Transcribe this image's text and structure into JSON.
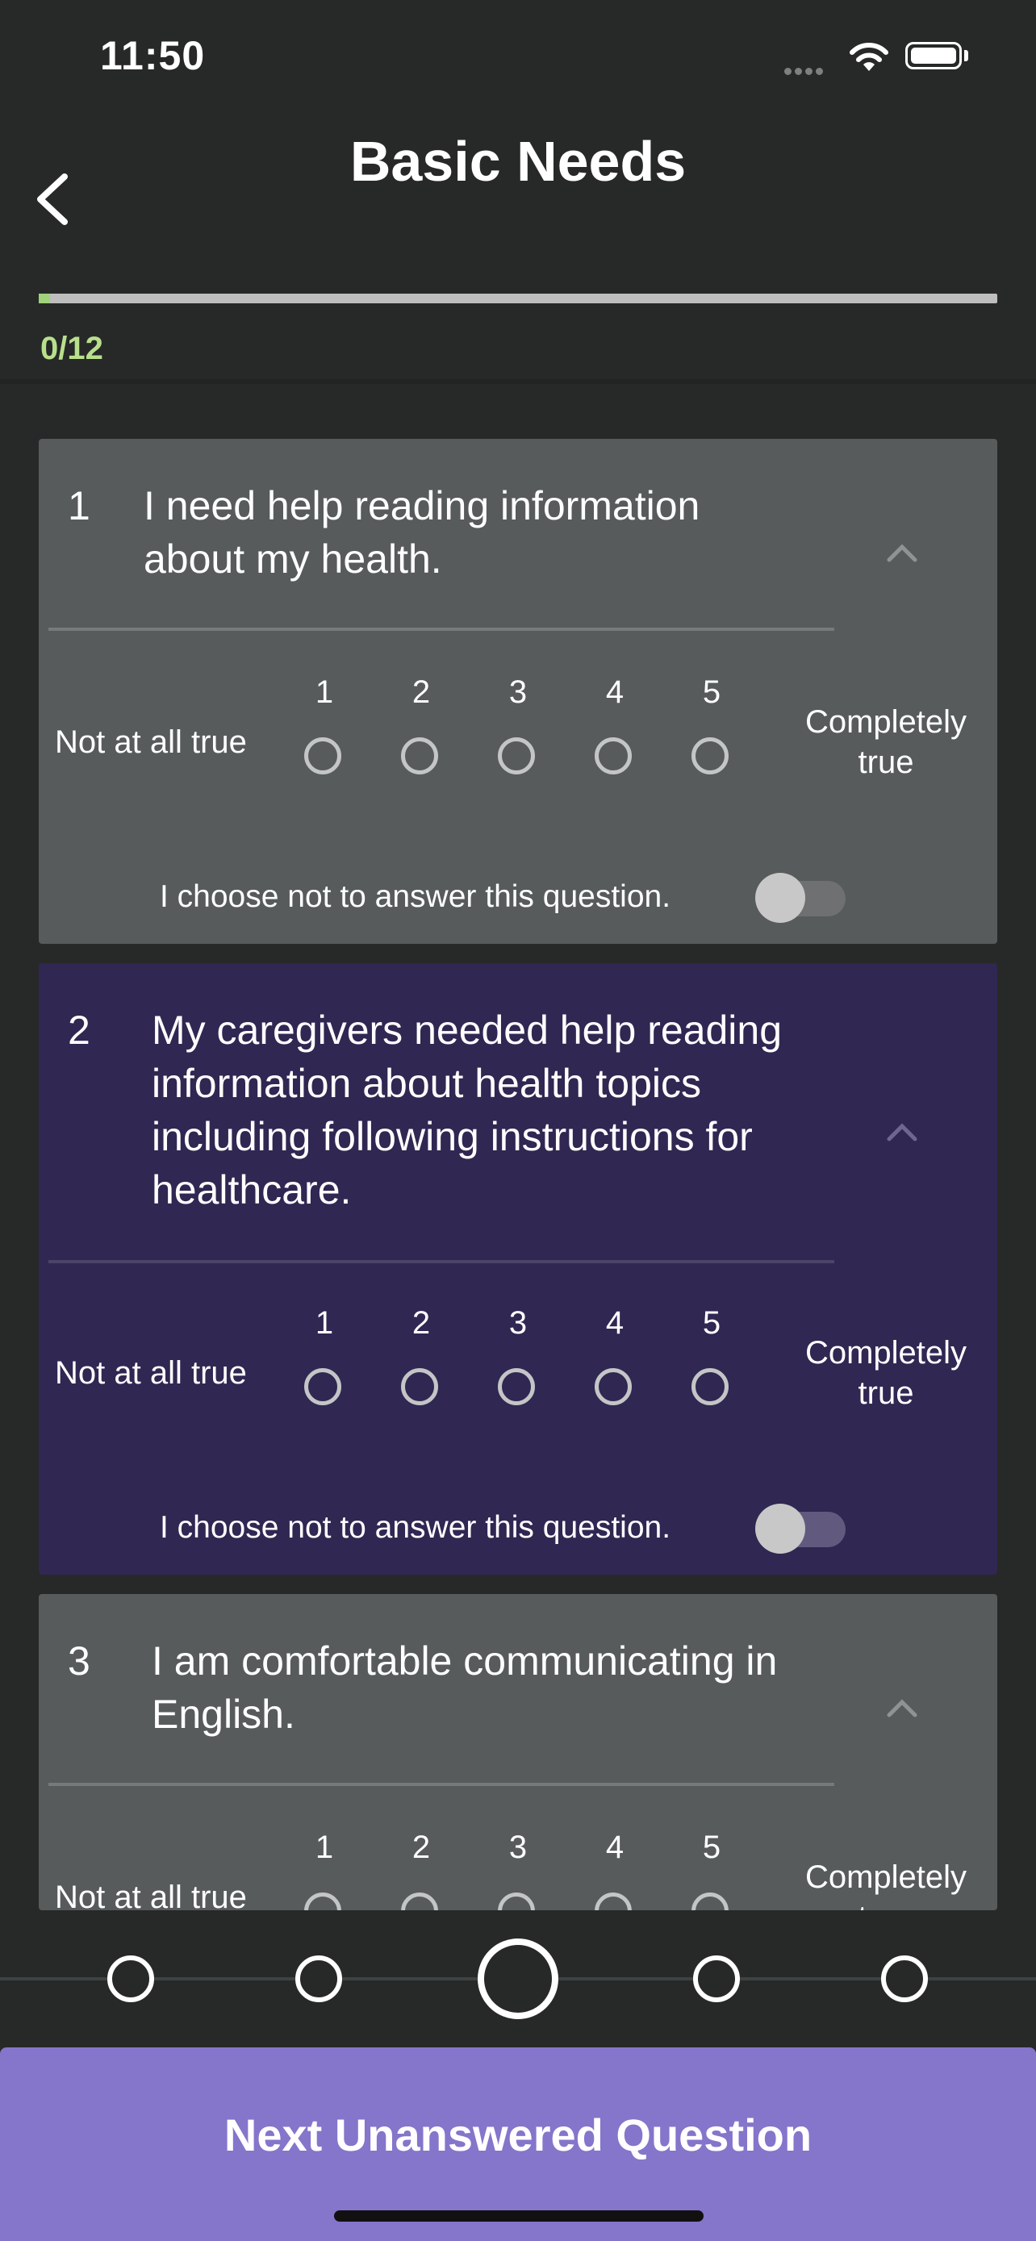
{
  "status_bar": {
    "time": "11:50"
  },
  "header": {
    "title": "Basic Needs",
    "progress_text": "0/12",
    "progress_fraction": 0.01
  },
  "scale": {
    "low_label": "Not at all true",
    "high_label": "Completely true",
    "numbers": [
      "1",
      "2",
      "3",
      "4",
      "5"
    ],
    "opt_out": "I choose not to answer this question."
  },
  "questions": [
    {
      "number": "1",
      "text": "I need help reading information about my health."
    },
    {
      "number": "2",
      "text": "My caregivers needed help reading information about health topics including following instructions for healthcare."
    },
    {
      "number": "3",
      "text": "I am comfortable communicating in English."
    }
  ],
  "footer": {
    "next_label": "Next Unanswered Question"
  },
  "colors": {
    "accent": "#8575cb",
    "active_card": "#302752",
    "card": "#575b5c",
    "progress": "#b8e08c"
  },
  "icons": {
    "back": "chevron-left-icon",
    "collapse": "chevron-up-icon",
    "wifi": "wifi-icon",
    "battery": "battery-icon"
  }
}
